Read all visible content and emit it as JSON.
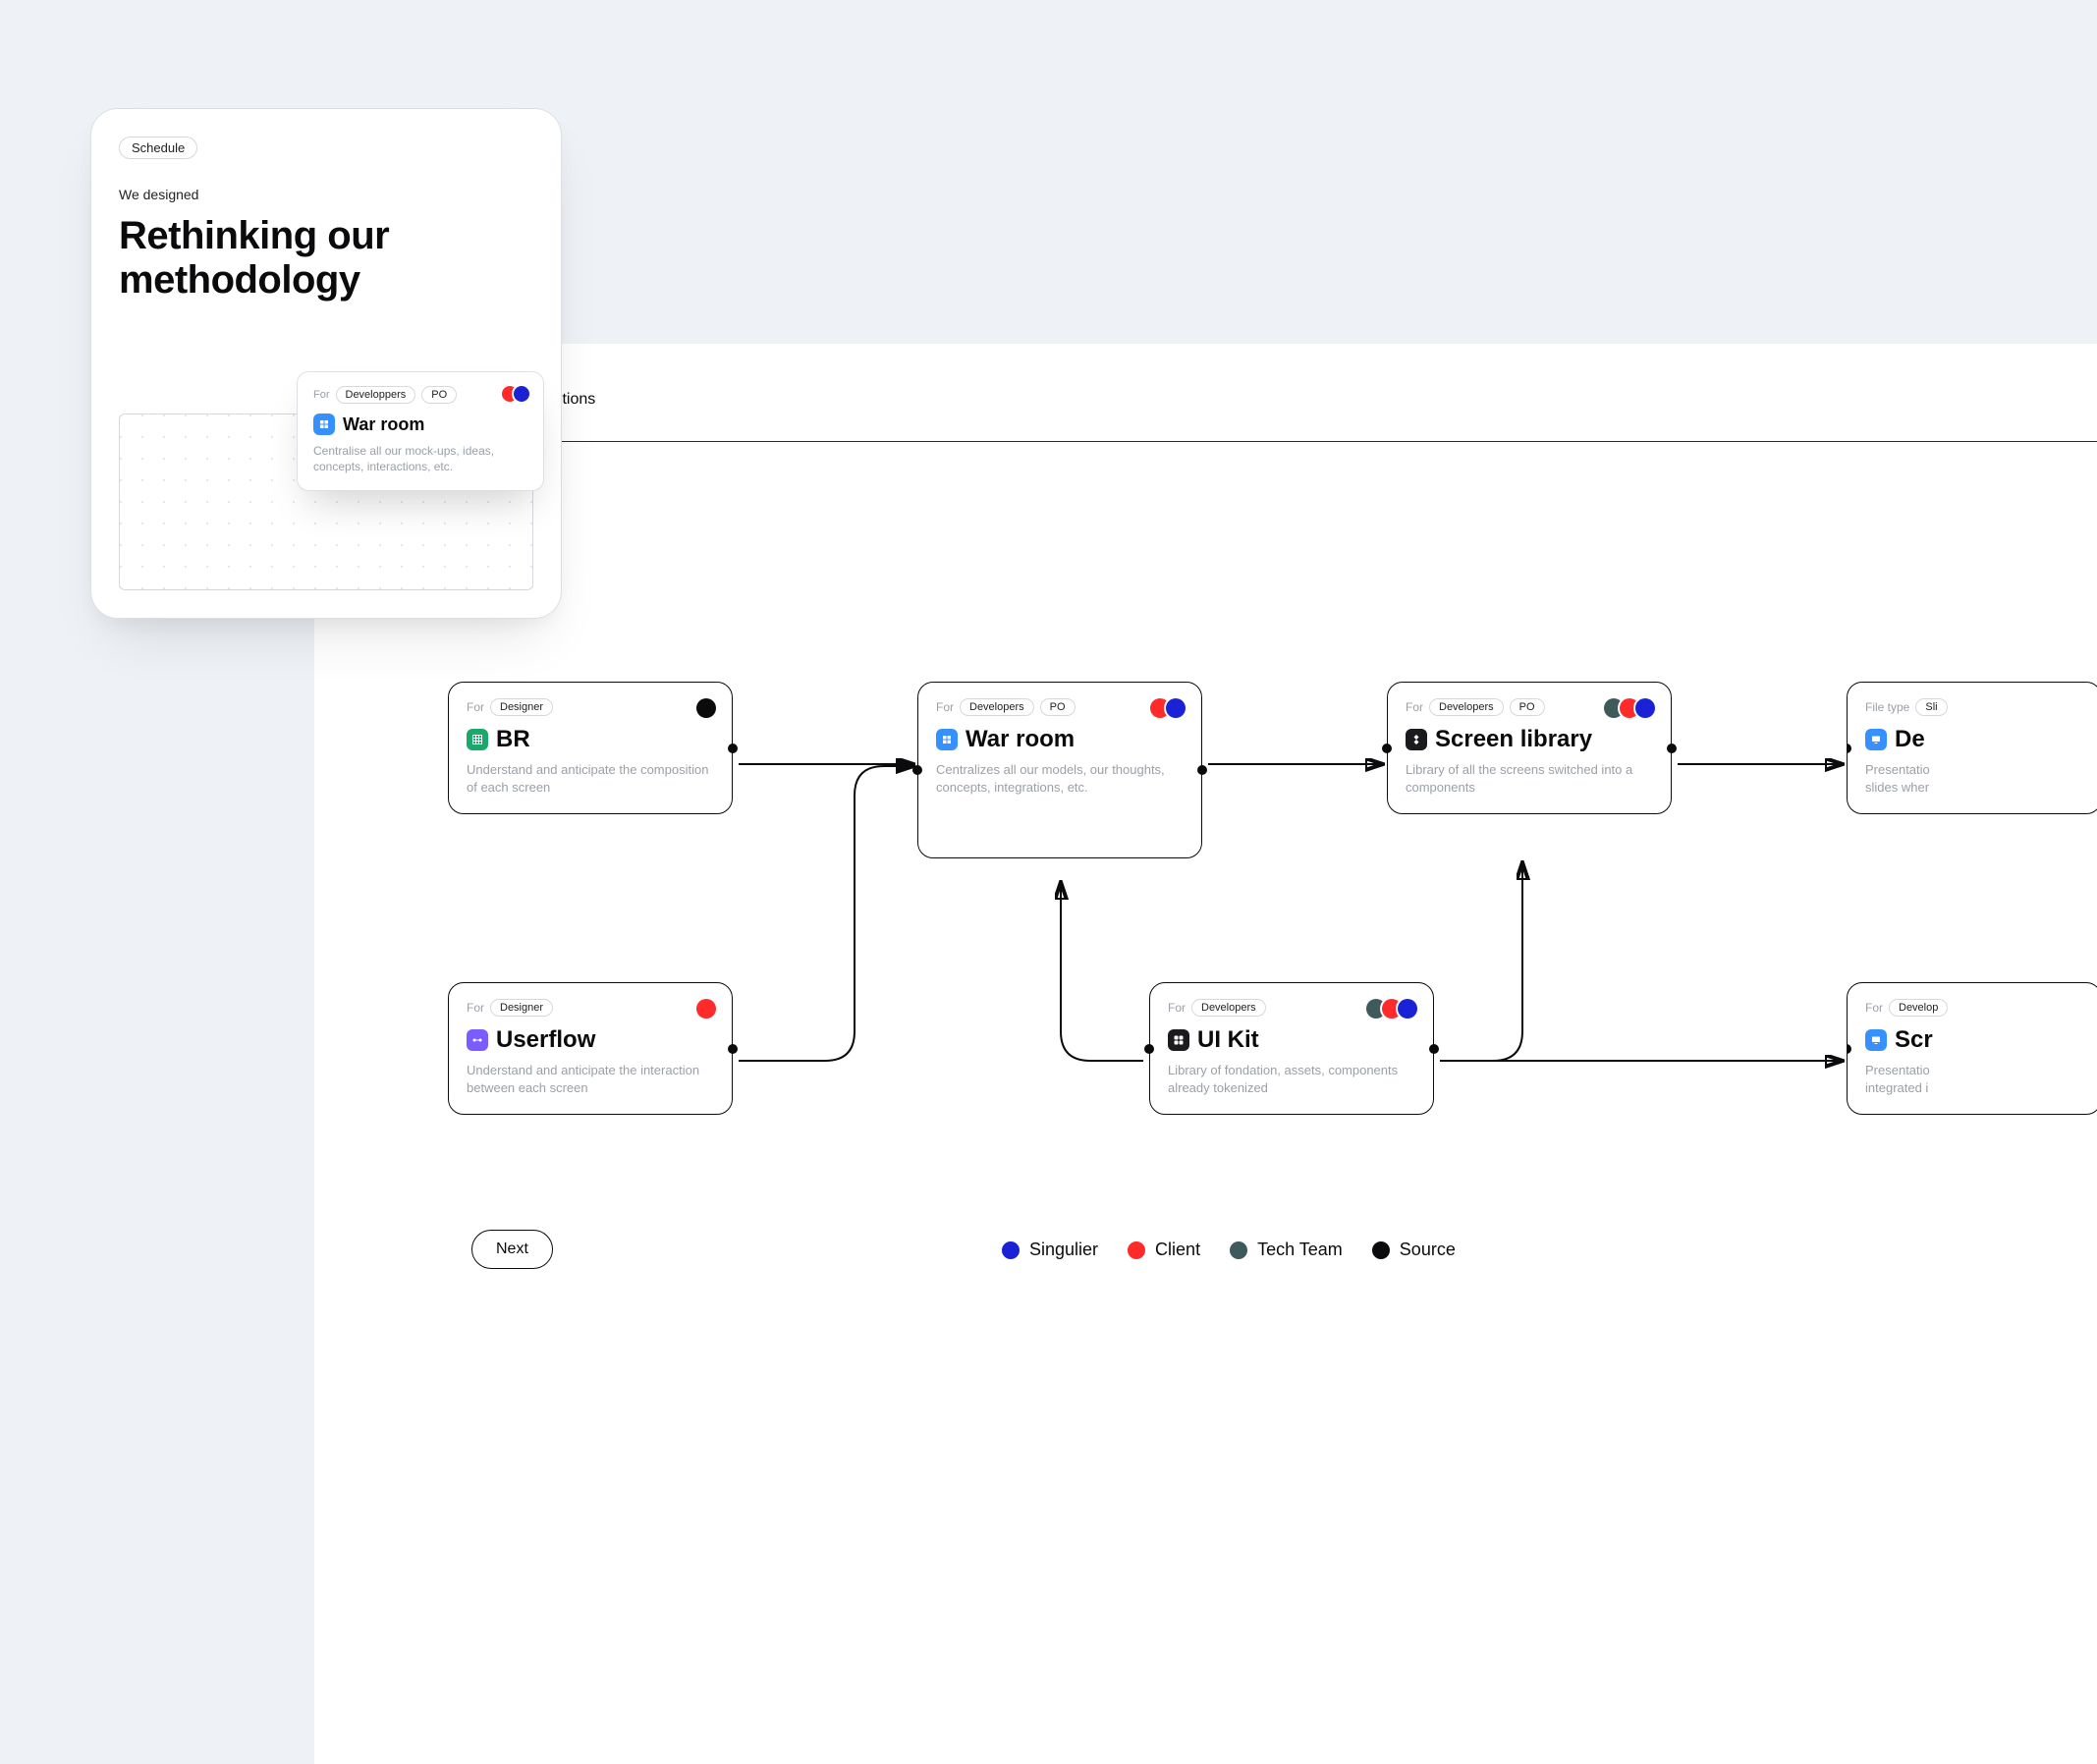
{
  "summary": {
    "badge": "Schedule",
    "eyebrow": "We designed",
    "title": "Rethinking our methodology",
    "mini": {
      "for_label": "For",
      "tags": [
        "Developpers",
        "PO"
      ],
      "title": "War room",
      "desc": "Centralise all our mock-ups, ideas, concepts, interactions, etc."
    }
  },
  "tabs": {
    "visible_fragment": "lutions"
  },
  "legend": {
    "singulier": "Singulier",
    "client": "Client",
    "tech": "Tech Team",
    "source": "Source"
  },
  "colors": {
    "singulier": "#1b22d6",
    "client": "#ff2b2b",
    "tech": "#3e5a5a",
    "source": "#0b0b0d"
  },
  "nodes": {
    "br": {
      "for_label": "For",
      "tags": [
        "Designer"
      ],
      "title": "BR",
      "desc": "Understand and anticipate the composition of each screen",
      "dots": [
        "source"
      ]
    },
    "warroom": {
      "for_label": "For",
      "tags": [
        "Developers",
        "PO"
      ],
      "title": "War room",
      "desc": "Centralizes all our models, our thoughts, concepts, integrations, etc.",
      "dots": [
        "client",
        "singulier"
      ]
    },
    "screenlib": {
      "for_label": "For",
      "tags": [
        "Developers",
        "PO"
      ],
      "title": "Screen library",
      "desc": "Library of all the screens switched into a components",
      "dots": [
        "tech",
        "client",
        "singulier"
      ]
    },
    "deck1": {
      "filetype_label": "File type",
      "filetype_tag": "Sli",
      "title": "De",
      "desc": "Presentatio\nslides wher"
    },
    "userflow": {
      "for_label": "For",
      "tags": [
        "Designer"
      ],
      "title": "Userflow",
      "desc": "Understand and anticipate the interaction between each screen",
      "dots": [
        "client"
      ]
    },
    "uikit": {
      "for_label": "For",
      "tags": [
        "Developers"
      ],
      "title": "UI Kit",
      "desc": "Library of fondation, assets, components already tokenized",
      "dots": [
        "tech",
        "client",
        "singulier"
      ]
    },
    "deck2": {
      "for_label": "For",
      "tags": [
        "Develop"
      ],
      "title": "Scr",
      "desc": "Presentatio\nintegrated i"
    }
  },
  "controls": {
    "next": "Next"
  }
}
